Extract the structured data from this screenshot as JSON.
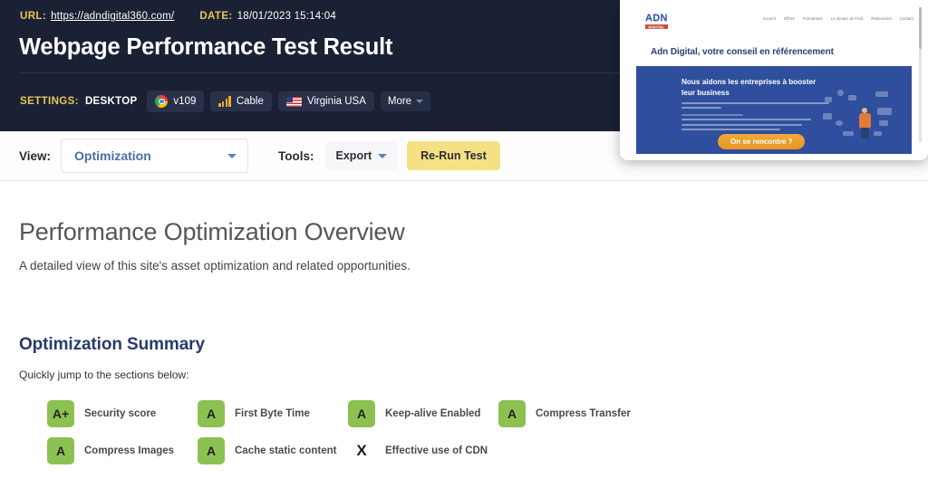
{
  "header": {
    "url_label": "URL:",
    "url_value": "https://adndigital360.com/",
    "date_label": "DATE:",
    "date_value": "18/01/2023 15:14:04",
    "title": "Webpage Performance Test Result",
    "settings_label": "SETTINGS:",
    "device": "DESKTOP",
    "chips": [
      {
        "icon": "chrome-icon",
        "label": "v109"
      },
      {
        "icon": "signal-bars-icon",
        "label": "Cable"
      },
      {
        "icon": "us-flag-icon",
        "label": "Virginia USA"
      },
      {
        "icon": "chevron-down-icon",
        "label": "More"
      }
    ]
  },
  "toolbar": {
    "view_label": "View:",
    "view_value": "Optimization",
    "tools_label": "Tools:",
    "export_label": "Export",
    "rerun_label": "Re-Run Test"
  },
  "main": {
    "overview_title": "Performance Optimization Overview",
    "overview_subtitle": "A detailed view of this site's asset optimization and related opportunities.",
    "summary_title": "Optimization Summary",
    "summary_subtitle": "Quickly jump to the sections below:",
    "grades": [
      {
        "grade": "A+",
        "label": "Security score",
        "status": "pass"
      },
      {
        "grade": "A",
        "label": "First Byte Time",
        "status": "pass"
      },
      {
        "grade": "A",
        "label": "Keep-alive Enabled",
        "status": "pass"
      },
      {
        "grade": "A",
        "label": "Compress Transfer",
        "status": "pass"
      },
      {
        "grade": "A",
        "label": "Compress Images",
        "status": "pass"
      },
      {
        "grade": "A",
        "label": "Cache static content",
        "status": "pass"
      },
      {
        "grade": "X",
        "label": "Effective use of CDN",
        "status": "fail"
      }
    ]
  },
  "thumbnail": {
    "logo": "ADN",
    "logo_sub": "DIGITAL",
    "nav": [
      "Accueil",
      "Offres",
      "Formations",
      "La minute de Fred",
      "Partenaires",
      "Contact"
    ],
    "heading": "Adn Digital, votre conseil en référencement",
    "hero_title": "Nous aidons les entreprises à booster leur business",
    "cta": "On se rencontre ?"
  },
  "colors": {
    "header_bg": "#1a2134",
    "accent_yellow": "#e8c55a",
    "grade_green": "#8cc152",
    "button_yellow": "#f5e184",
    "select_blue": "#4a6fa8",
    "heading_navy": "#2b3a6b",
    "hero_blue": "#2f4e9e"
  }
}
